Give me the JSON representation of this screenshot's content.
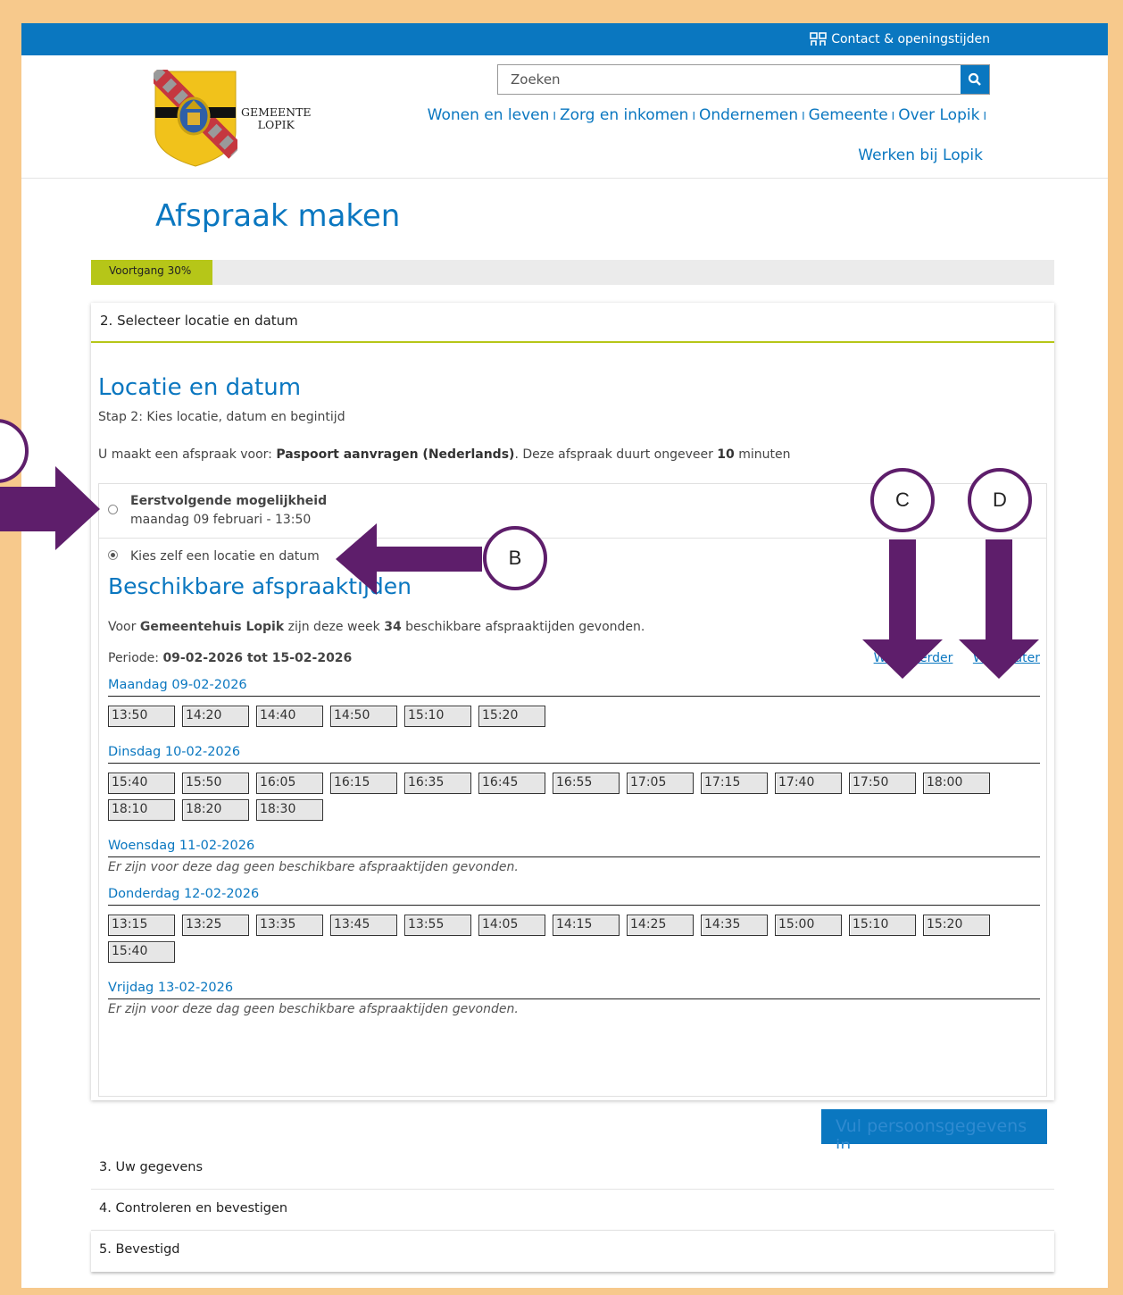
{
  "topbar": {
    "contact_label": "Contact & openingstijden",
    "contact_icon": "people-icon"
  },
  "header": {
    "logo_text_line1": "GEMEENTE",
    "logo_text_line2": "LOPIK",
    "search_placeholder": "Zoeken",
    "nav": [
      "Wonen en leven",
      "Zorg en inkomen",
      "Ondernemen",
      "Gemeente",
      "Over Lopik"
    ],
    "nav_line2": "Werken bij Lopik",
    "separator": "I"
  },
  "page_title": "Afspraak maken",
  "progress": {
    "label": "Voortgang 30%",
    "value": 0.3
  },
  "step2": {
    "header": "2. Selecteer locatie en datum",
    "title": "Locatie en datum",
    "subtitle": "Stap 2: Kies locatie, datum en begintijd",
    "intro_prefix": "U maakt een afspraak voor: ",
    "intro_service": "Paspoort aanvragen (Nederlands)",
    "intro_middle": ". Deze afspraak duurt ongeveer ",
    "intro_minutes": "10",
    "intro_suffix": " minuten",
    "option1_title": "Eerstvolgende mogelijkheid",
    "option1_date": "maandag 09 februari - 13:50",
    "option2_title": "Kies zelf een locatie en datum",
    "available_title": "Beschikbare afspraaktijden",
    "found_prefix": "Voor ",
    "found_location": "Gemeentehuis Lopik",
    "found_middle": " zijn deze week ",
    "found_count": "34",
    "found_suffix": " beschikbare afspraaktijden gevonden.",
    "periode_label": "Periode: ",
    "periode_value": "09-02-2026 tot 15-02-2026",
    "week_earlier": "Week eerder",
    "week_later": "Week later"
  },
  "days": [
    {
      "label": "Maandag 09-02-2026",
      "slots": [
        "13:50",
        "14:20",
        "14:40",
        "14:50",
        "15:10",
        "15:20"
      ]
    },
    {
      "label": "Dinsdag 10-02-2026",
      "slots": [
        "15:40",
        "15:50",
        "16:05",
        "16:15",
        "16:35",
        "16:45",
        "16:55",
        "17:05",
        "17:15",
        "17:40",
        "17:50",
        "18:00",
        "18:10",
        "18:20",
        "18:30"
      ]
    },
    {
      "label": "Woensdag 11-02-2026",
      "slots": [],
      "empty_text": "Er zijn voor deze dag geen beschikbare afspraaktijden gevonden."
    },
    {
      "label": "Donderdag 12-02-2026",
      "slots": [
        "13:15",
        "13:25",
        "13:35",
        "13:45",
        "13:55",
        "14:05",
        "14:15",
        "14:25",
        "14:35",
        "15:00",
        "15:10",
        "15:20",
        "15:40"
      ]
    },
    {
      "label": "Vrijdag 13-02-2026",
      "slots": [],
      "empty_text": "Er zijn voor deze dag geen beschikbare afspraaktijden gevonden."
    }
  ],
  "next_button": "Vul persoonsgegevens in",
  "later_steps": [
    "3. Uw gegevens",
    "4. Controleren en bevestigen",
    "5. Bevestigd"
  ],
  "annotations": {
    "b": "B",
    "c": "C",
    "d": "D",
    "arrow_color": "#5e1e6b"
  },
  "colors": {
    "brand_blue": "#0a77c0",
    "progress_green": "#b6c618",
    "frame": "#f7c98c"
  }
}
